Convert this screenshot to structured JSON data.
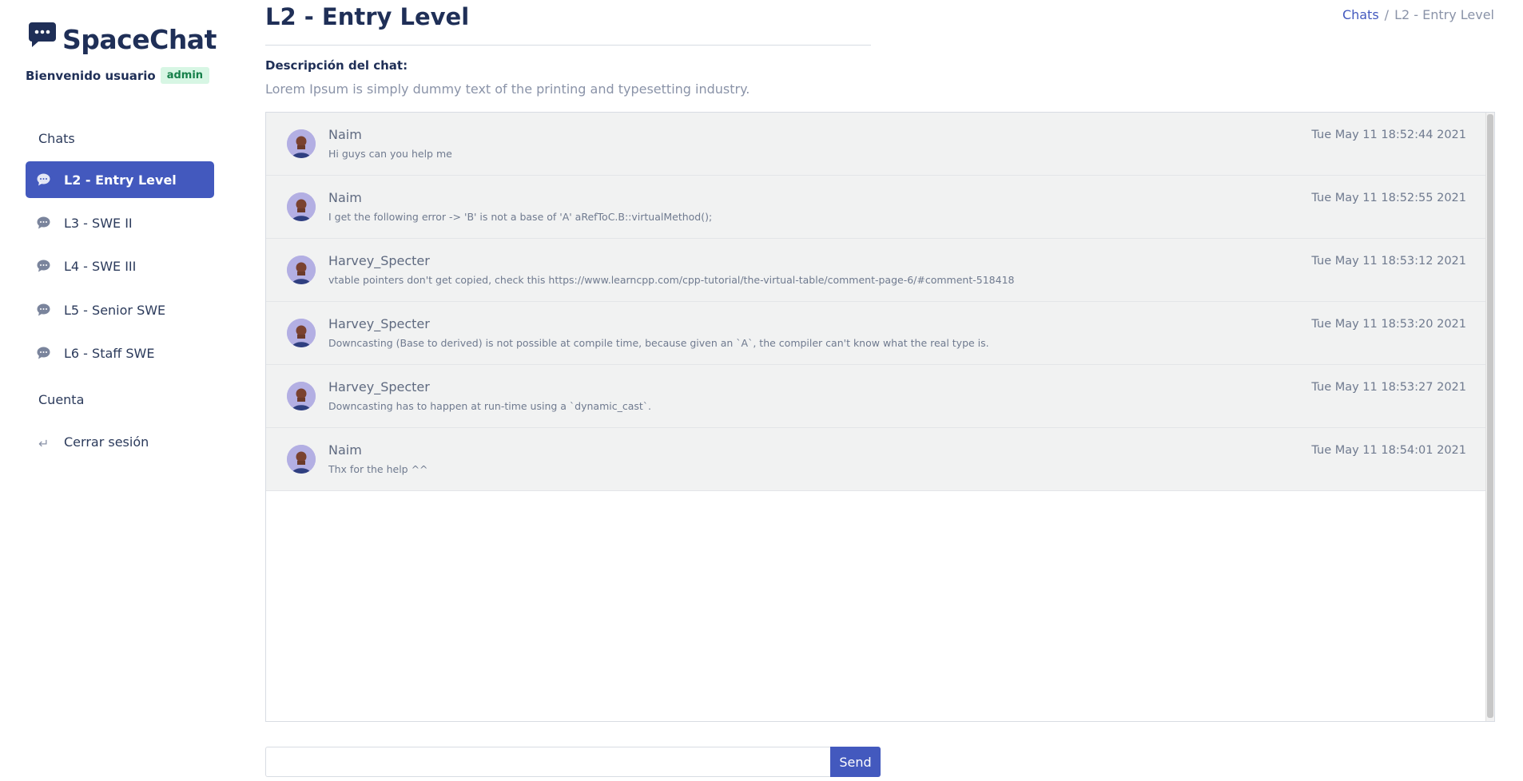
{
  "sidebar": {
    "brand": "SpaceChat",
    "welcome": "Bienvenido usuario",
    "role_badge": "admin",
    "chats_section": "Chats",
    "chats": [
      {
        "label": "L2 - Entry Level",
        "active": true
      },
      {
        "label": "L3 - SWE II",
        "active": false
      },
      {
        "label": "L4 - SWE III",
        "active": false
      },
      {
        "label": "L5 - Senior SWE",
        "active": false
      },
      {
        "label": "L6 - Staff SWE",
        "active": false
      }
    ],
    "account_section": "Cuenta",
    "logout": "Cerrar sesión"
  },
  "header": {
    "title": "L2 - Entry Level",
    "breadcrumb": [
      "Chats",
      "L2 - Entry Level"
    ],
    "breadcrumb_separator": "/"
  },
  "description": {
    "label": "Descripción del chat:",
    "text": "Lorem Ipsum is simply dummy text of the printing and typesetting industry."
  },
  "messages": [
    {
      "user": "Naim",
      "text": "Hi guys can you help me",
      "time": "Tue May 11 18:52:44 2021"
    },
    {
      "user": "Naim",
      "text": "I get the following error -> 'B' is not a base of 'A' aRefToC.B::virtualMethod();",
      "time": "Tue May 11 18:52:55 2021"
    },
    {
      "user": "Harvey_Specter",
      "text": "vtable pointers don't get copied, check this https://www.learncpp.com/cpp-tutorial/the-virtual-table/comment-page-6/#comment-518418",
      "time": "Tue May 11 18:53:12 2021"
    },
    {
      "user": "Harvey_Specter",
      "text": "Downcasting (Base to derived) is not possible at compile time, because given an `A`, the compiler can't know what the real type is.",
      "time": "Tue May 11 18:53:20 2021"
    },
    {
      "user": "Harvey_Specter",
      "text": "Downcasting has to happen at run-time using a `dynamic_cast`.",
      "time": "Tue May 11 18:53:27 2021"
    },
    {
      "user": "Naim",
      "text": "Thx for the help ^^",
      "time": "Tue May 11 18:54:01 2021"
    }
  ],
  "composer": {
    "value": "",
    "placeholder": "",
    "send_label": "Send"
  },
  "colors": {
    "accent": "#4359be",
    "navy": "#1f2f57",
    "message_bg": "#f1f2f2",
    "badge_bg": "#d7f6e4"
  }
}
